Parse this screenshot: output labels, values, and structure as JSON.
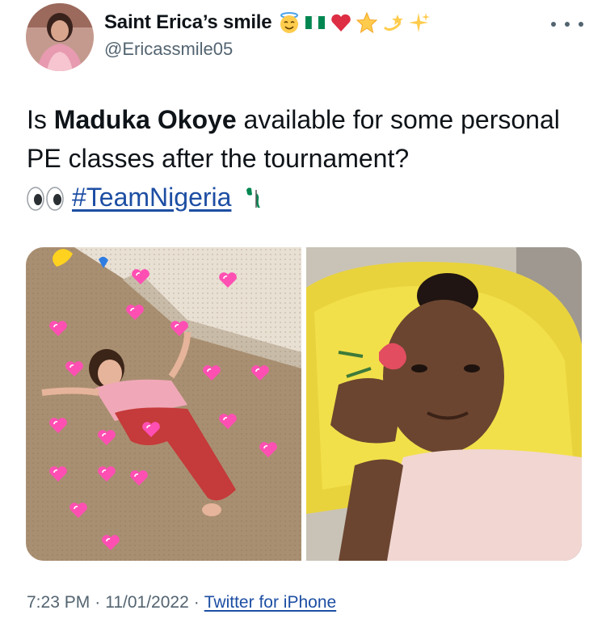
{
  "tweet": {
    "author": {
      "display_name": "Saint Erica’s smile",
      "handle": "@Ericassmile05",
      "name_emojis": [
        "smiling-face-with-halo",
        "nigeria-flag",
        "red-heart",
        "star",
        "dizzy",
        "sparkles"
      ]
    },
    "text": {
      "prefix": "Is ",
      "bold_name": "Maduka Okoye",
      "rest": " available for some personal PE classes after the tournament?",
      "hashtag": "#TeamNigeria",
      "leading_emoji": "eyes",
      "trailing_emoji": "africa-flag"
    },
    "media": [
      {
        "description_icon": "child-with-hearts-photo"
      },
      {
        "description_icon": "woman-with-flower-photo"
      }
    ],
    "meta": {
      "time": "7:23 PM",
      "date": "11/01/2022",
      "source": "Twitter for iPhone",
      "separator": "·"
    }
  },
  "colors": {
    "text_primary": "#0f1419",
    "text_secondary": "#536471",
    "link": "#1d4ea3",
    "background": "#ffffff"
  }
}
